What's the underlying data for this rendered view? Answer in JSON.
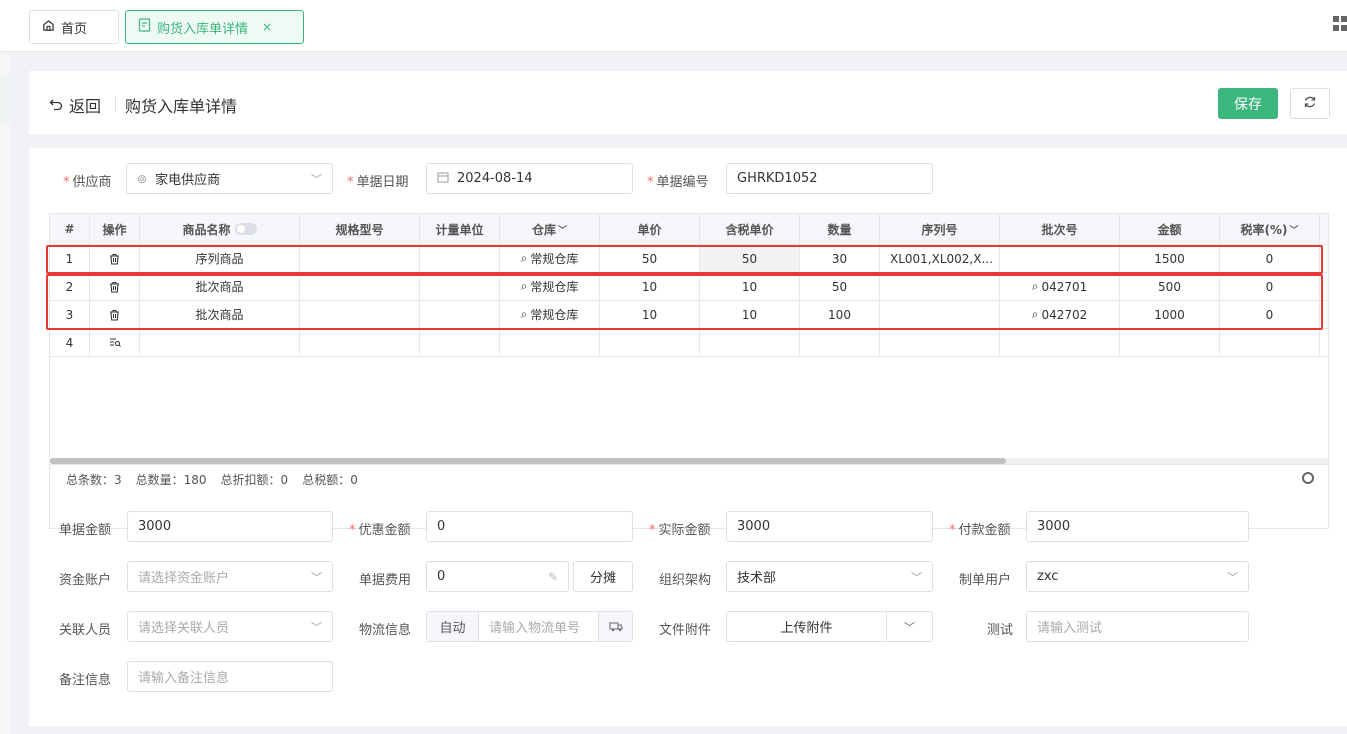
{
  "tabs": {
    "home": "首页",
    "active": "购货入库单详情",
    "close": "×"
  },
  "header": {
    "back": "返回",
    "title": "购货入库单详情",
    "save": "保存"
  },
  "form_top": {
    "supplier_label": "供应商",
    "supplier_value": "家电供应商",
    "date_label": "单据日期",
    "date_value": "2024-08-14",
    "no_label": "单据编号",
    "no_value": "GHRKD1052"
  },
  "table": {
    "headers": [
      "#",
      "操作",
      "商品名称",
      "规格型号",
      "计量单位",
      "仓库",
      "单价",
      "含税单价",
      "数量",
      "序列号",
      "批次号",
      "金额",
      "税率(%)"
    ],
    "rows": [
      {
        "idx": "1",
        "name": "序列商品",
        "spec": "",
        "unit": "",
        "warehouse": "常规仓库",
        "price": "50",
        "tax_price": "50",
        "qty": "30",
        "serial": "XL001,XL002,X...",
        "batch": "",
        "amount": "1500",
        "tax_rate": "0"
      },
      {
        "idx": "2",
        "name": "批次商品",
        "spec": "",
        "unit": "",
        "warehouse": "常规仓库",
        "price": "10",
        "tax_price": "10",
        "qty": "50",
        "serial": "",
        "batch": "042701",
        "amount": "500",
        "tax_rate": "0"
      },
      {
        "idx": "3",
        "name": "批次商品",
        "spec": "",
        "unit": "",
        "warehouse": "常规仓库",
        "price": "10",
        "tax_price": "10",
        "qty": "100",
        "serial": "",
        "batch": "042702",
        "amount": "1000",
        "tax_rate": "0"
      },
      {
        "idx": "4"
      }
    ],
    "summary": {
      "count": "总条数：3",
      "qty": "总数量：180",
      "discount": "总折扣额：0",
      "tax": "总税额：0"
    }
  },
  "form_bottom": {
    "doc_amount_label": "单据金额",
    "doc_amount": "3000",
    "discount_label": "优惠金额",
    "discount": "0",
    "actual_label": "实际金额",
    "actual": "3000",
    "pay_label": "付款金额",
    "pay": "3000",
    "account_label": "资金账户",
    "account_ph": "请选择资金账户",
    "fee_label": "单据费用",
    "fee": "0",
    "split": "分摊",
    "org_label": "组织架构",
    "org": "技术部",
    "maker_label": "制单用户",
    "maker": "zxc",
    "person_label": "关联人员",
    "person_ph": "请选择关联人员",
    "logistics_label": "物流信息",
    "logistics_auto": "自动",
    "logistics_ph": "请输入物流单号",
    "file_label": "文件附件",
    "upload": "上传附件",
    "test_label": "测试",
    "test_ph": "请输入测试",
    "remark_label": "备注信息",
    "remark_ph": "请输入备注信息"
  },
  "colors": {
    "accent": "#3bb67d",
    "highlight": "#e53935"
  }
}
